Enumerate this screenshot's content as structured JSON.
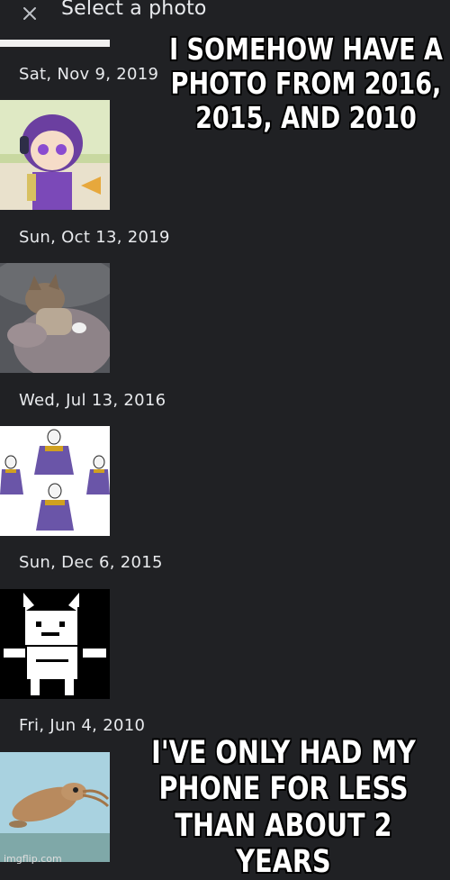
{
  "header": {
    "title": "Select a photo",
    "close_icon": "close-icon"
  },
  "groups": [
    {
      "date": "Sat, Nov 9, 2019",
      "photo": "anime-character-thumbnail"
    },
    {
      "date": "Sun, Oct 13, 2019",
      "photo": "cat-thumbnail"
    },
    {
      "date": "Wed, Jul 13, 2016",
      "photo": "goat-characters-thumbnail"
    },
    {
      "date": "Sun, Dec 6, 2015",
      "photo": "pixel-cat-thumbnail"
    },
    {
      "date": "Fri, Jun 4, 2010",
      "photo": "squid-thumbnail"
    }
  ],
  "meme": {
    "top_text": "I SOMEHOW HAVE A PHOTO FROM 2016, 2015, AND 2010",
    "bottom_text": "I'VE ONLY HAD MY PHONE FOR LESS THAN ABOUT 2 YEARS"
  },
  "watermark": "imgflip.com",
  "colors": {
    "background": "#202124",
    "text": "#e8eaed"
  }
}
